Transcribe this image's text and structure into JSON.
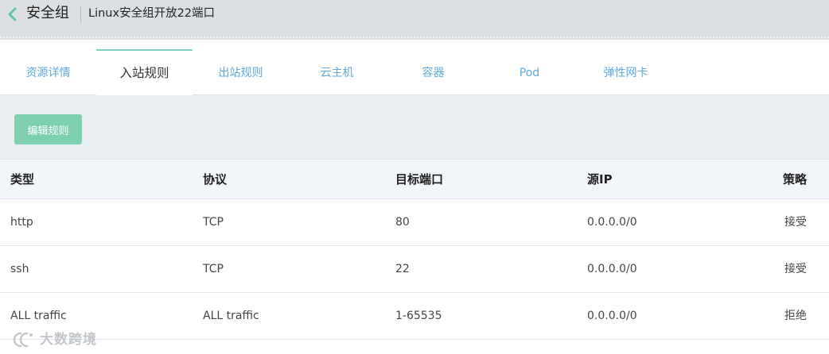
{
  "header": {
    "title": "安全组",
    "subtitle": "Linux安全组开放22端口",
    "back_icon": "chevron-left-icon"
  },
  "tabs": [
    {
      "label": "资源详情",
      "active": false
    },
    {
      "label": "入站规则",
      "active": true
    },
    {
      "label": "出站规则",
      "active": false
    },
    {
      "label": "云主机",
      "active": false
    },
    {
      "label": "容器",
      "active": false
    },
    {
      "label": "Pod",
      "active": false
    },
    {
      "label": "弹性网卡",
      "active": false
    }
  ],
  "toolbar": {
    "edit_label": "编辑规则"
  },
  "table": {
    "columns": [
      "类型",
      "协议",
      "目标端口",
      "源IP",
      "策略"
    ],
    "rows": [
      [
        "http",
        "TCP",
        "80",
        "0.0.0.0/0",
        "接受"
      ],
      [
        "ssh",
        "TCP",
        "22",
        "0.0.0.0/0",
        "接受"
      ],
      [
        "ALL traffic",
        "ALL traffic",
        "1-65535",
        "0.0.0.0/0",
        "拒绝"
      ]
    ]
  },
  "watermark": {
    "text": "大数跨境"
  },
  "colors": {
    "accent": "#5fa9dc",
    "button": "#7fcfb1",
    "active_tab_border": "#7fd0c1",
    "header_bg": "#dde0e3",
    "toolbar_bg": "#e8edf1"
  }
}
